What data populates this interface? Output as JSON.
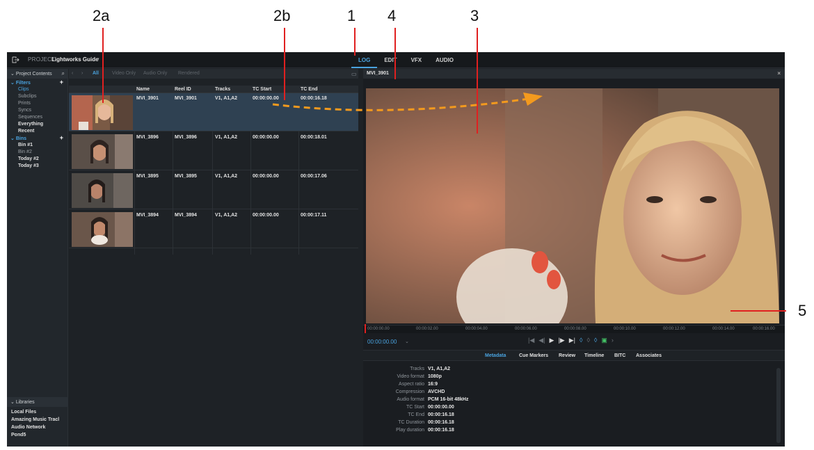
{
  "annotations": {
    "labels": [
      "2a",
      "2b",
      "1",
      "4",
      "3",
      "5"
    ]
  },
  "topbar": {
    "project_label": "PROJECT:",
    "project_name": "Lightworks Guide",
    "tabs": [
      "LOG",
      "EDIT",
      "VFX",
      "AUDIO"
    ],
    "active_tab": "LOG"
  },
  "sidebar": {
    "header": "Project Contents",
    "filters_label": "Filters",
    "filters": [
      "Clips",
      "Subclips",
      "Prints",
      "Syncs",
      "Sequences",
      "Everything",
      "Recent"
    ],
    "bins_label": "Bins",
    "bins": [
      "Bin #1",
      "Bin #2",
      "Today #2",
      "Today #3"
    ],
    "libraries_label": "Libraries",
    "libraries": [
      "Local Files",
      "Amazing Music Tracl",
      "Audio Network",
      "Pond5"
    ]
  },
  "bin": {
    "filter_tabs": [
      "All",
      "Video Only",
      "Audio Only",
      "Rendered"
    ],
    "columns": [
      "Name",
      "Reel ID",
      "Tracks",
      "TC Start",
      "TC End"
    ],
    "rows": [
      {
        "name": "MVI_3901",
        "reel": "MVI_3901",
        "tracks": "V1, A1,A2",
        "tc_start": "00:00:00.00",
        "tc_end": "00:00:16.18"
      },
      {
        "name": "MVI_3896",
        "reel": "MVI_3896",
        "tracks": "V1, A1,A2",
        "tc_start": "00:00:00.00",
        "tc_end": "00:00:18.01"
      },
      {
        "name": "MVI_3895",
        "reel": "MVI_3895",
        "tracks": "V1, A1,A2",
        "tc_start": "00:00:00.00",
        "tc_end": "00:00:17.06"
      },
      {
        "name": "MVI_3894",
        "reel": "MVI_3894",
        "tracks": "V1, A1,A2",
        "tc_start": "00:00:00.00",
        "tc_end": "00:00:17.11"
      }
    ]
  },
  "viewer": {
    "title": "MVI_3901",
    "timecode": "00:00:00.00",
    "ruler": [
      "00:00:00.00",
      "00:00:02.00",
      "00:00:04.00",
      "00:00:06.00",
      "00:00:08.00",
      "00:00:10.00",
      "00:00:12.00",
      "00:00:14.00",
      "00:00:16.00"
    ],
    "meta_tabs": [
      "Metadata",
      "Cue Markers",
      "Review",
      "Timeline",
      "BITC",
      "Associates"
    ],
    "active_meta_tab": "Metadata",
    "metadata": [
      {
        "k": "Tracks",
        "v": "V1, A1,A2"
      },
      {
        "k": "Video format",
        "v": "1080p"
      },
      {
        "k": "Aspect ratio",
        "v": "16:9"
      },
      {
        "k": "Compression",
        "v": "AVCHD"
      },
      {
        "k": "Audio format",
        "v": "PCM 16-bit 48kHz"
      },
      {
        "k": "TC Start",
        "v": "00:00:00.00"
      },
      {
        "k": "TC End",
        "v": "00:00:16.18"
      },
      {
        "k": "TC Duration",
        "v": "00:00:16.18"
      },
      {
        "k": "Play duration",
        "v": "00:00:16.18"
      }
    ]
  },
  "colors": {
    "accent": "#4aa3df",
    "annotation_red": "#e02020",
    "arrow_orange": "#f39a1e"
  }
}
